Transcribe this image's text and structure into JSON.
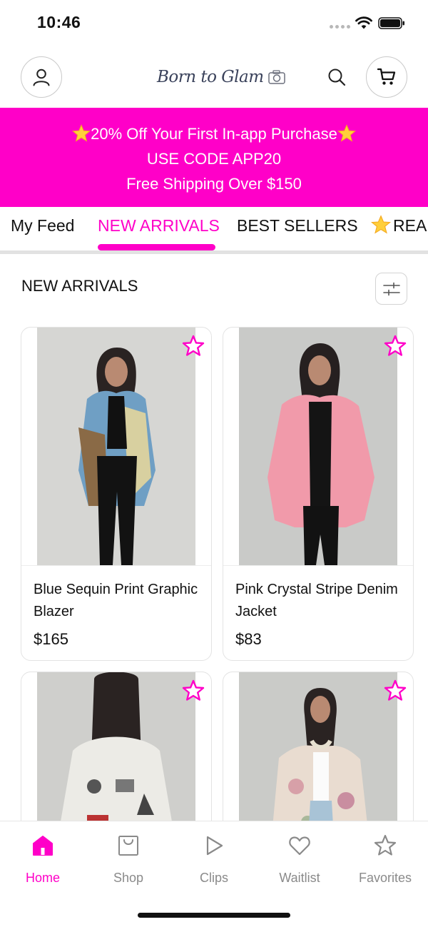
{
  "status_bar": {
    "time": "10:46"
  },
  "header": {
    "brand": "Born to Glam",
    "icons": [
      "account-icon",
      "search-icon",
      "cart-icon",
      "camera-icon"
    ]
  },
  "promo": {
    "line1": "20% Off Your First In-app Purchase",
    "line2": "USE CODE APP20",
    "line3": "Free Shipping Over $150",
    "background": "#ff00c8"
  },
  "tabs": [
    {
      "label": "My Feed",
      "active": false
    },
    {
      "label": "NEW ARRIVALS",
      "active": true
    },
    {
      "label": "BEST SELLERS",
      "active": false
    },
    {
      "label": "READ",
      "active": false
    }
  ],
  "section": {
    "title": "NEW ARRIVALS"
  },
  "products": [
    {
      "name": "Blue Sequin Print Graphic Blazer",
      "price": "$165",
      "favorite": false
    },
    {
      "name": "Pink Crystal Stripe Denim Jacket",
      "price": "$83",
      "favorite": false
    },
    {
      "name": "",
      "price": "",
      "favorite": false
    },
    {
      "name": "",
      "price": "",
      "favorite": false
    }
  ],
  "bottom_nav": [
    {
      "label": "Home",
      "icon": "home-icon",
      "active": true
    },
    {
      "label": "Shop",
      "icon": "shopping-bag-icon",
      "active": false
    },
    {
      "label": "Clips",
      "icon": "play-icon",
      "active": false
    },
    {
      "label": "Waitlist",
      "icon": "heart-icon",
      "active": false
    },
    {
      "label": "Favorites",
      "icon": "star-icon",
      "active": false
    }
  ],
  "colors": {
    "accent": "#ff00c8",
    "text": "#111111",
    "muted": "#8a8a8a"
  }
}
